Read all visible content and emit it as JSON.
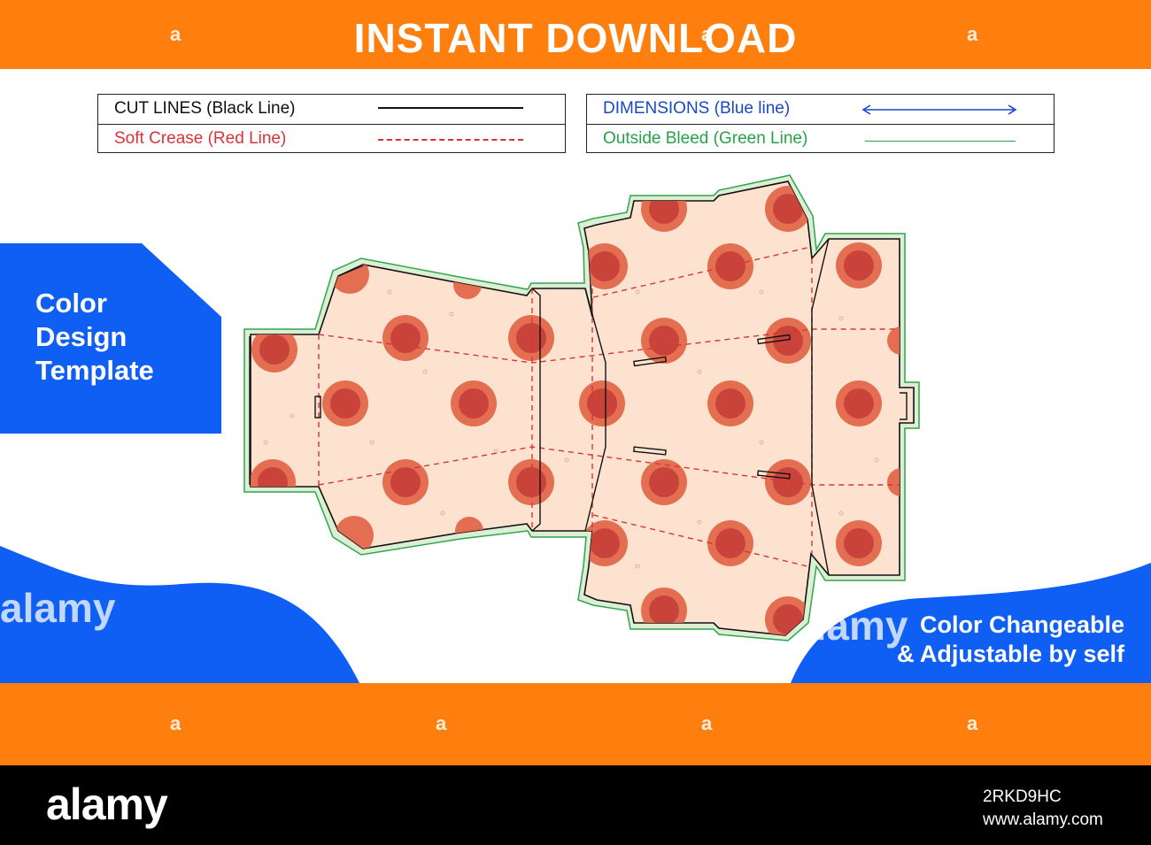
{
  "header": {
    "title": "INSTANT DOWNLOAD"
  },
  "watermark": {
    "glyph": "a",
    "word": "alamy"
  },
  "legend": {
    "cut": {
      "label": "CUT LINES (Black Line)",
      "color": "#111111"
    },
    "crease": {
      "label": "Soft Crease (Red Line)",
      "color": "#d8333a"
    },
    "dimensions": {
      "label": "DIMENSIONS (Blue line)",
      "color": "#1848c8"
    },
    "bleed": {
      "label": "Outside Bleed (Green Line)",
      "color": "#27a24a"
    }
  },
  "left_badge": {
    "line1": "Color",
    "line2": "Design",
    "line3": "Template"
  },
  "right_badge": {
    "line1": "Color Changeable",
    "line2": "& Adjustable by self"
  },
  "footer": {
    "logo": "alamy",
    "image_id": "2RKD9HC",
    "site": "www.alamy.com"
  },
  "colors": {
    "orange": "#ff7f0e",
    "blue": "#0f5ff5",
    "panel_fill": "#fde3cf",
    "pizza_outer": "#e2684a",
    "pizza_inner": "#c9433b",
    "bleed_green": "#2fa64c",
    "crease_red": "#d8333a"
  }
}
